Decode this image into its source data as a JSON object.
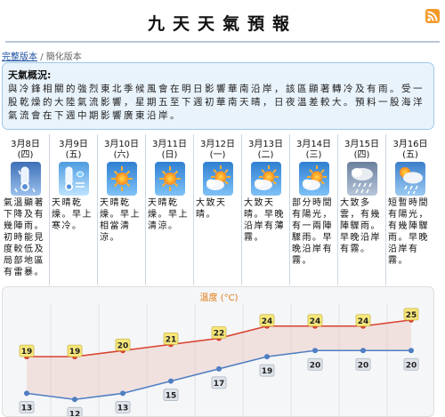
{
  "header": {
    "title": "九天天氣預報",
    "rss_icon": "rss-icon"
  },
  "versions": {
    "full": "完整版本",
    "separator": "/",
    "simple": "簡化版本"
  },
  "overview": {
    "heading": "天氣概況:",
    "text": "與冷鋒相關的強烈東北季候風會在明日影響華南沿岸，該區顯著轉冷及有雨。受一股乾燥的大陸氣流影響，星期五至下週初華南天晴，日夜溫差較大。預料一股海洋氣流會在下週中期影響廣東沿岸。"
  },
  "days": [
    {
      "date": "3月8日",
      "weekday": "(四)",
      "icon": "cold-rain-icon",
      "desc": "氣溫顯著下降及有幾陣雨。初時能見度較低及局部地區有雷暴。"
    },
    {
      "date": "3月9日",
      "weekday": "(五)",
      "icon": "cold-dry-icon",
      "desc": "天晴乾燥。早上寒冷。"
    },
    {
      "date": "3月10日",
      "weekday": "(六)",
      "icon": "sunny-icon",
      "desc": "天晴乾燥。早上相當清涼。"
    },
    {
      "date": "3月11日",
      "weekday": "(日)",
      "icon": "sunny-icon",
      "desc": "天晴乾燥。早上清涼。"
    },
    {
      "date": "3月12日",
      "weekday": "(一)",
      "icon": "sunny-periods-icon",
      "desc": "大致天晴。"
    },
    {
      "date": "3月13日",
      "weekday": "(二)",
      "icon": "sunny-periods-icon",
      "desc": "大致天晴。早晚沿岸有薄霧。"
    },
    {
      "date": "3月14日",
      "weekday": "(三)",
      "icon": "sunny-periods-icon",
      "desc": "部分時間有陽光，有一兩陣驟雨。早晚沿岸有霧。"
    },
    {
      "date": "3月15日",
      "weekday": "(四)",
      "icon": "showers-icon",
      "desc": "大致多雲，有幾陣驟雨。早晚沿岸有霧。"
    },
    {
      "date": "3月16日",
      "weekday": "(五)",
      "icon": "sunny-showers-icon",
      "desc": "短暫時間有陽光，有幾陣驟雨。早晚沿岸有霧。"
    }
  ],
  "chart_data": {
    "type": "line",
    "title": "溫度 (°C)",
    "categories": [
      "3月8日",
      "3月9日",
      "3月10日",
      "3月11日",
      "3月12日",
      "3月13日",
      "3月14日",
      "3月15日",
      "3月16日"
    ],
    "series": [
      {
        "values": [
          19,
          19,
          20,
          21,
          22,
          24,
          24,
          24,
          25
        ],
        "color": "#d9412e"
      },
      {
        "values": [
          13,
          12,
          13,
          15,
          17,
          19,
          20,
          20,
          20
        ],
        "color": "#4f7ec2"
      }
    ],
    "ylim": [
      10,
      26
    ],
    "grid": true
  },
  "colors": {
    "accent": "#e07b17",
    "panel": "#e9f3fb",
    "panel_border": "#9fc9ea"
  }
}
